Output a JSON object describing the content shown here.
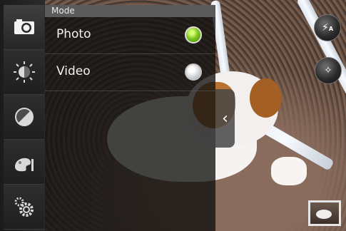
{
  "mode_menu": {
    "title": "Mode",
    "items": [
      {
        "label": "Photo",
        "selected": true
      },
      {
        "label": "Video",
        "selected": false
      }
    ]
  },
  "left_toolbar": {
    "buttons": [
      {
        "icon": "camera-icon"
      },
      {
        "icon": "white-balance-icon"
      },
      {
        "icon": "exposure-icon"
      },
      {
        "icon": "color-effect-icon"
      },
      {
        "icon": "settings-gears-icon"
      }
    ]
  },
  "right_controls": {
    "flash": {
      "icon": "flash-auto-icon",
      "mode_text": "A"
    },
    "focus": {
      "icon": "focus-mode-icon"
    },
    "thumbnail": {
      "icon": "last-photo-thumbnail"
    }
  },
  "colors": {
    "selected_radio": "#79c01c",
    "panel_bg": "#0f0f0f",
    "title_bar": "#5b5b5b"
  }
}
